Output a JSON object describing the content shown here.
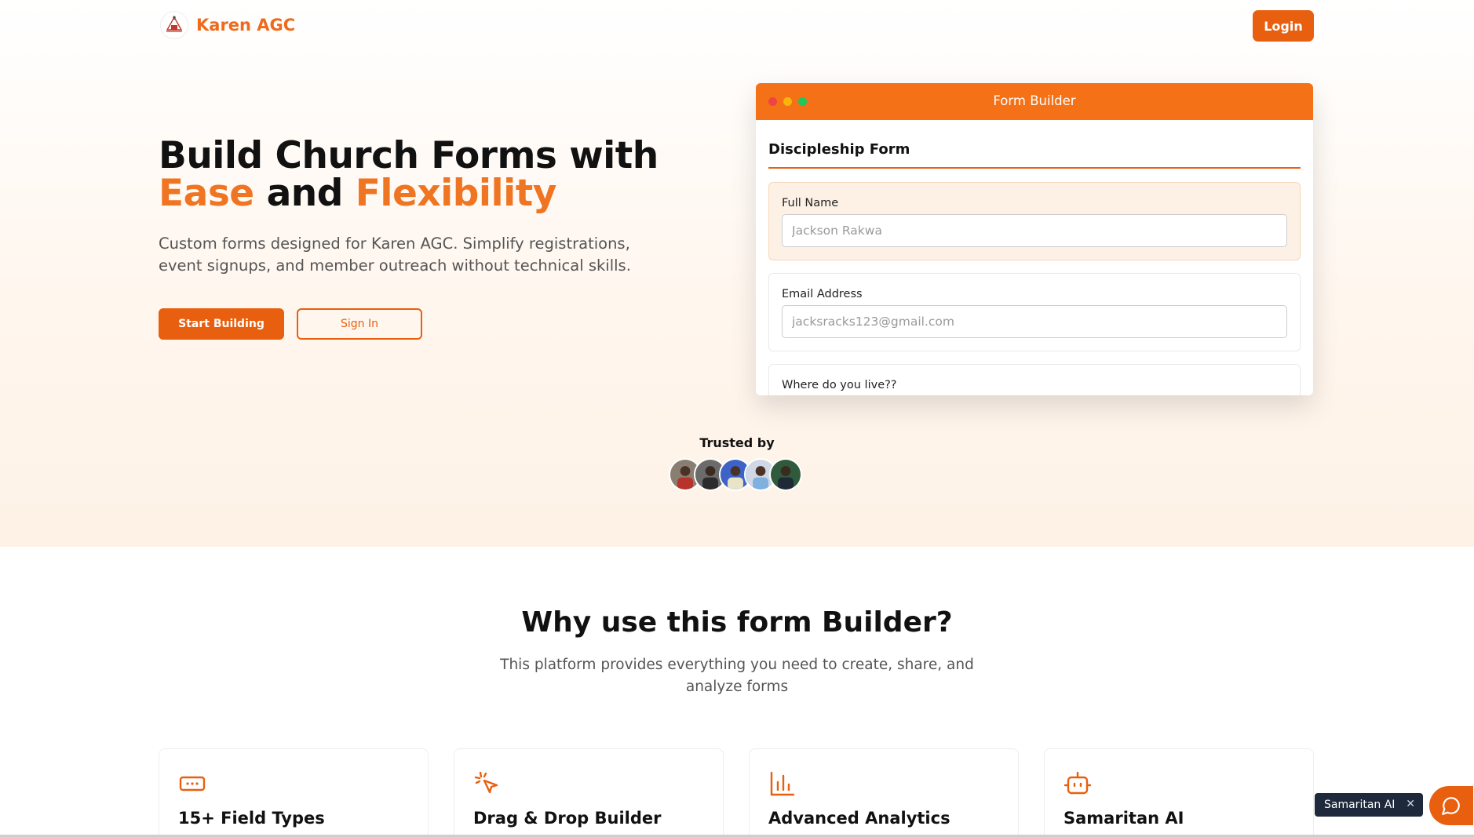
{
  "header": {
    "brand": "Karen AGC",
    "login_label": "Login",
    "logo_icon": "church-logo-icon"
  },
  "hero": {
    "headline_line1": "Build Church Forms with",
    "headline_accent1": "Ease",
    "headline_and": "and",
    "headline_accent2": "Flexibility",
    "subtext": "Custom forms designed for Karen AGC. Simplify registrations, event signups, and member outreach without technical skills.",
    "start_label": "Start Building",
    "signin_label": "Sign In"
  },
  "form_builder": {
    "window_title": "Form Builder",
    "form_title": "Discipleship Form",
    "fields": [
      {
        "label": "Full Name",
        "placeholder": "Jackson Rakwa"
      },
      {
        "label": "Email Address",
        "placeholder": "jacksracks123@gmail.com"
      },
      {
        "label": "Where do you live??"
      }
    ]
  },
  "trusted": {
    "label": "Trusted by",
    "avatar_count": 5
  },
  "why": {
    "title": "Why use this form Builder?",
    "subtitle": "This platform provides everything you need to create, share, and analyze forms",
    "cards": [
      {
        "icon": "input-field-icon",
        "title": "15+ Field Types"
      },
      {
        "icon": "mouse-pointer-click-icon",
        "title": "Drag & Drop Builder"
      },
      {
        "icon": "bar-chart-icon",
        "title": "Advanced Analytics"
      },
      {
        "icon": "bot-icon",
        "title": "Samaritan AI"
      }
    ]
  },
  "chat": {
    "label": "Samaritan AI",
    "icon": "chat-bubble-icon"
  },
  "colors": {
    "accent": "#e8600f",
    "accent_light": "#f47117",
    "dark": "#111111"
  }
}
